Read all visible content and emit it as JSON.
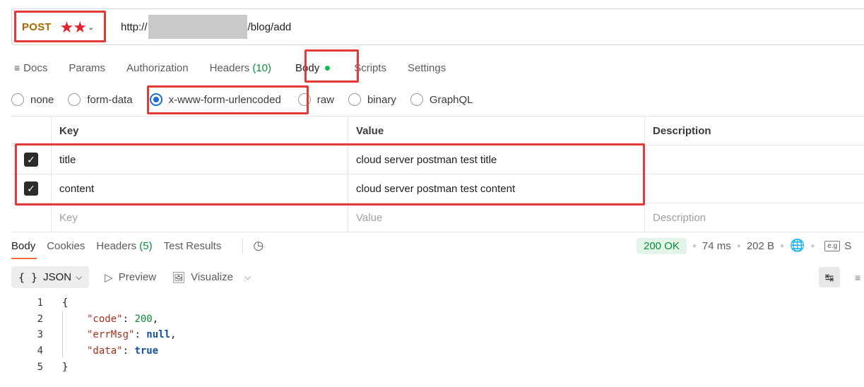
{
  "request": {
    "method": "POST",
    "method_stars": "★★",
    "url_prefix": "http://",
    "url_suffix": "/blog/add"
  },
  "request_tabs": [
    {
      "label": "Docs"
    },
    {
      "label": "Params"
    },
    {
      "label": "Authorization"
    },
    {
      "label": "Headers",
      "count": "(10)"
    },
    {
      "label": "Body"
    },
    {
      "label": "Scripts"
    },
    {
      "label": "Settings"
    }
  ],
  "body_types": [
    "none",
    "form-data",
    "x-www-form-urlencoded",
    "raw",
    "binary",
    "GraphQL"
  ],
  "selected_body_type": "x-www-form-urlencoded",
  "table": {
    "headers": [
      "Key",
      "Value",
      "Description"
    ],
    "rows": [
      {
        "key": "title",
        "value": "cloud server postman test title",
        "description": ""
      },
      {
        "key": "content",
        "value": "cloud server postman test content",
        "description": ""
      }
    ],
    "placeholder": {
      "key": "Key",
      "value": "Value",
      "description": "Description"
    }
  },
  "response_tabs": [
    {
      "label": "Body"
    },
    {
      "label": "Cookies"
    },
    {
      "label": "Headers",
      "count": "(5)"
    },
    {
      "label": "Test Results"
    }
  ],
  "response_status": {
    "code": "200 OK",
    "time": "74 ms",
    "size": "202 B",
    "save_partial": "S"
  },
  "response_toolbar": {
    "format": "JSON",
    "preview": "Preview",
    "visualize": "Visualize"
  },
  "response_body": {
    "line_numbers": [
      "1",
      "2",
      "3",
      "4",
      "5"
    ],
    "open": "{",
    "close": "}",
    "fields": [
      {
        "key": "\"code\"",
        "value": "200",
        "trail": ","
      },
      {
        "key": "\"errMsg\"",
        "value": "null",
        "trail": ","
      },
      {
        "key": "\"data\"",
        "value": "true",
        "trail": ""
      }
    ]
  },
  "colors": {
    "highlight": "#e53935",
    "method": "#a66a00",
    "accent_blue": "#1a6fd6",
    "success_green": "#0b8a3a"
  }
}
